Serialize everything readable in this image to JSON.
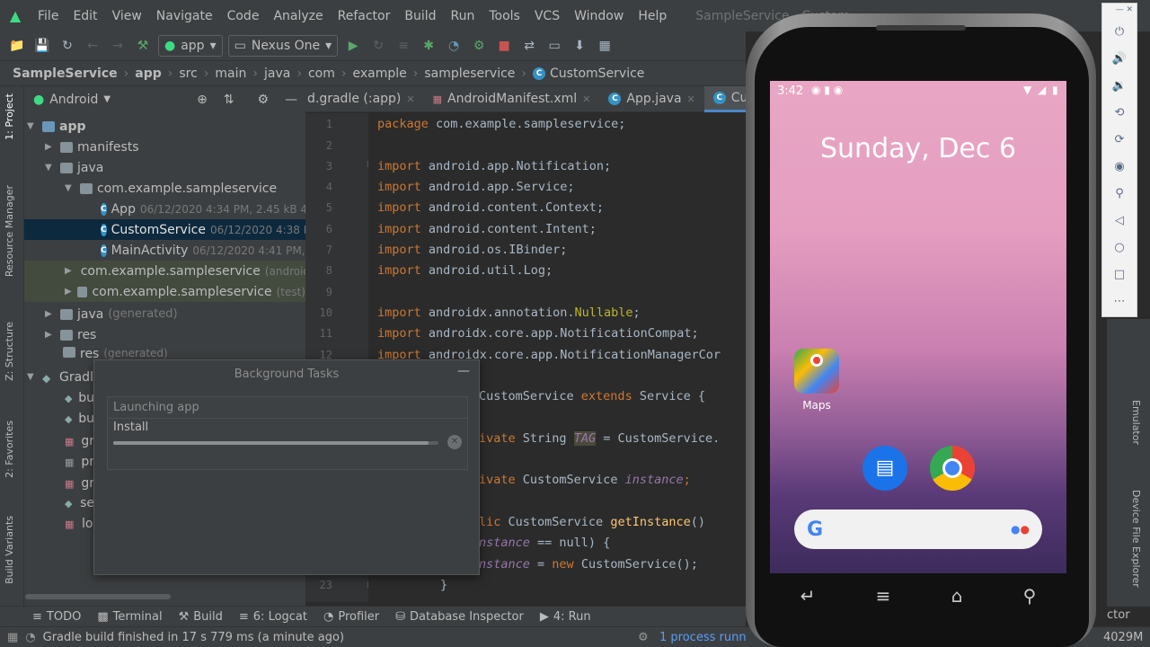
{
  "menu": {
    "items": [
      "File",
      "Edit",
      "View",
      "Navigate",
      "Code",
      "Analyze",
      "Refactor",
      "Build",
      "Run",
      "Tools",
      "VCS",
      "Window",
      "Help"
    ],
    "window_title": "SampleService - Custom"
  },
  "toolbar": {
    "module": "app",
    "device": "Nexus One"
  },
  "breadcrumb": [
    "SampleService",
    "app",
    "src",
    "main",
    "java",
    "com",
    "example",
    "sampleservice",
    "CustomService"
  ],
  "project": {
    "view": "Android",
    "tree": [
      {
        "label": "app",
        "meta": ""
      },
      {
        "label": "manifests",
        "meta": ""
      },
      {
        "label": "java",
        "meta": ""
      },
      {
        "label": "com.example.sampleservice",
        "meta": ""
      },
      {
        "label": "App",
        "meta": "06/12/2020 4:34 PM, 2.45 kB 4"
      },
      {
        "label": "CustomService",
        "meta": "06/12/2020 4:38 PM"
      },
      {
        "label": "MainActivity",
        "meta": "06/12/2020 4:41 PM, 2"
      },
      {
        "label": "com.example.sampleservice",
        "meta": "(android"
      },
      {
        "label": "com.example.sampleservice",
        "meta": "(test)"
      },
      {
        "label": "java",
        "meta": "(generated)"
      },
      {
        "label": "res",
        "meta": ""
      },
      {
        "label": "res",
        "meta": "(generated)"
      },
      {
        "label": "Gradl",
        "meta": ""
      },
      {
        "label": "bu",
        "meta": ""
      },
      {
        "label": "bu",
        "meta": ""
      },
      {
        "label": "gr",
        "meta": ""
      },
      {
        "label": "pr",
        "meta": ""
      },
      {
        "label": "gr",
        "meta": ""
      },
      {
        "label": "se",
        "meta": ""
      },
      {
        "label": "lo",
        "meta": ""
      }
    ]
  },
  "side_tabs": {
    "project": "1: Project",
    "resource": "Resource Manager",
    "structure": "Z: Structure",
    "favorites": "2: Favorites",
    "variants": "Build Variants"
  },
  "editor_tabs": [
    "d.gradle (:app)",
    "AndroidManifest.xml",
    "App.java",
    "Custo"
  ],
  "line_numbers": [
    "1",
    "2",
    "3",
    "4",
    "5",
    "6",
    "7",
    "8",
    "9",
    "10",
    "11",
    "12",
    "23"
  ],
  "code": {
    "l1a": "package ",
    "l1b": "com.example.sampleservice;",
    "imp": "import ",
    "i3": "android.app.Notification;",
    "i4": "android.app.Service;",
    "i5": "android.content.Context;",
    "i6": "android.content.Intent;",
    "i7": "android.os.IBinder;",
    "i8": "android.util.Log;",
    "i10a": "androidx.annotation.",
    "i10b": "Nullable",
    ";": ";",
    "i11": "androidx.core.app.NotificationCompat;",
    "i12": "androidx.core.app.NotificationManagerCor",
    "c14a": "CustomService ",
    "c14b": "extends ",
    "c14c": "Service {",
    "c16a": "ivate ",
    "c16b": "String ",
    "c16c": "TAG",
    " c16d": " = CustomService.",
    "c18a": "ivate ",
    "c18b": "CustomService ",
    "c18c": "instance",
    ";2": ";",
    "c20a": "lic ",
    "c20b": "CustomService ",
    "c20c": "getInstance",
    "c20d": "() ",
    "c21a": "nstance",
    " c21b": " == null) {",
    "c22a": "nstance",
    " c22b": " = ",
    "c22c": "new ",
    "c22d": "CustomService();",
    "c23": "}"
  },
  "background_tasks": {
    "title": "Background Tasks",
    "task1": "Launching app",
    "task2": "Install",
    "progress": 0.97
  },
  "bottom_tabs": [
    "TODO",
    "Terminal",
    "Build",
    "6: Logcat",
    "Profiler",
    "Database Inspector",
    "4: Run"
  ],
  "status": {
    "message": "Gradle build finished in 17 s 779 ms (a minute ago)",
    "process": "1 process runn",
    "memory": "4029M",
    "right_frag": "ctor"
  },
  "right_tabs": {
    "emulator": "Emulator",
    "device_explorer": "Device File Explorer"
  },
  "phone": {
    "time": "3:42",
    "date": "Sunday, Dec 6",
    "app_maps": "Maps"
  },
  "colors": {
    "accent": "#3592c4",
    "android_green": "#3ddc84",
    "keyword": "#cc7832",
    "annotation": "#bbb529"
  }
}
